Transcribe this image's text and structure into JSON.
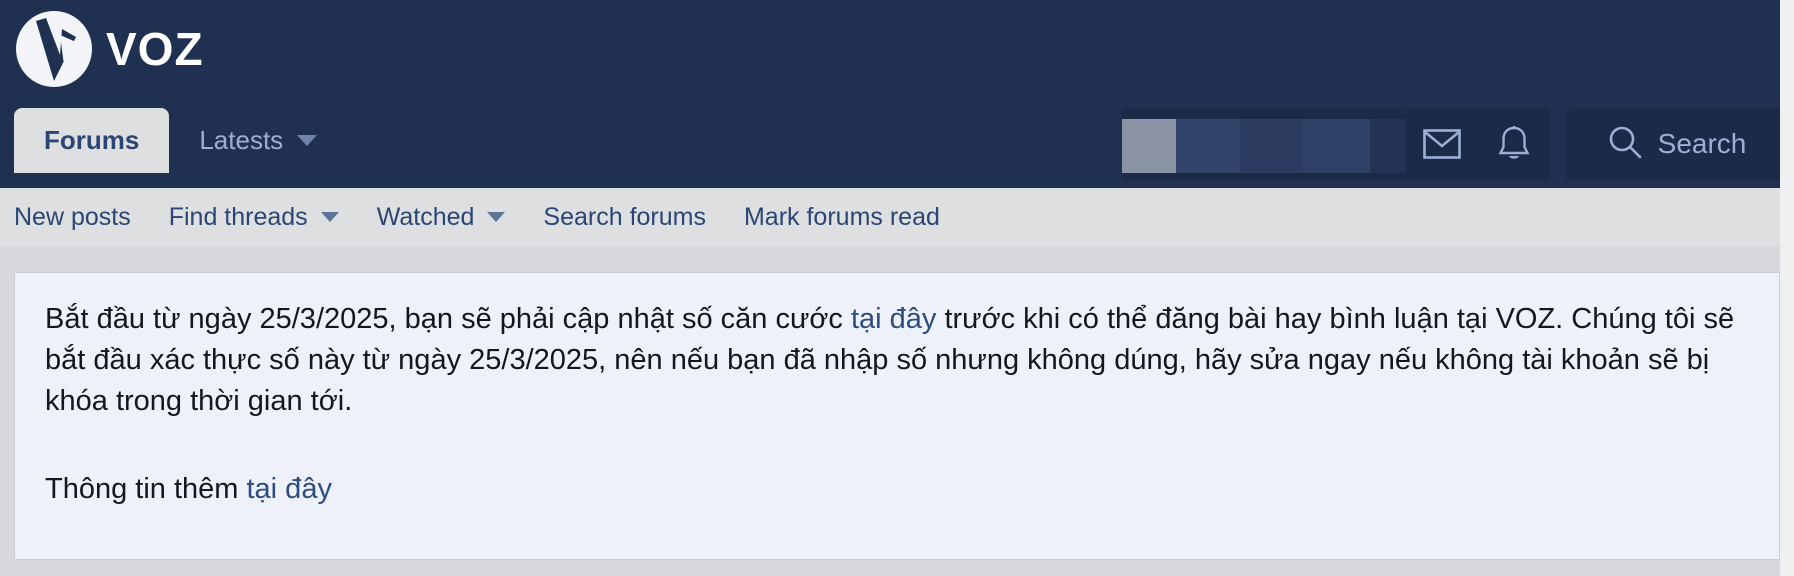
{
  "brand": {
    "name": "VOZ",
    "logo_icon": "voz-logo-icon",
    "background_color": "#1f3050"
  },
  "primary_nav": {
    "items": [
      {
        "label": "Forums",
        "active": true,
        "has_caret": false
      },
      {
        "label": "Latests",
        "active": false,
        "has_caret": true
      }
    ]
  },
  "header_right": {
    "account": {
      "label": "",
      "state": "redacted",
      "avatar_icon": "avatar"
    },
    "inbox_icon": "envelope-icon",
    "alerts_icon": "bell-icon",
    "search": {
      "label": "Search",
      "icon": "search-icon"
    }
  },
  "secondary_nav": {
    "items": [
      {
        "label": "New posts",
        "has_caret": false
      },
      {
        "label": "Find threads",
        "has_caret": true
      },
      {
        "label": "Watched",
        "has_caret": true
      },
      {
        "label": "Search forums",
        "has_caret": false
      },
      {
        "label": "Mark forums read",
        "has_caret": false
      }
    ]
  },
  "notice": {
    "paragraph1_part1": "Bắt đầu từ ngày 25/3/2025, bạn sẽ phải cập nhật số căn cước ",
    "paragraph1_link": "tại đây",
    "paragraph1_part2": " trước khi có thể đăng bài hay bình luận tại VOZ. Chúng tôi sẽ bắt đầu xác thực số này từ ngày 25/3/2025, nên nếu bạn đã nhập số nhưng không dúng, hãy sửa ngay nếu không tài khoản sẽ bị khóa trong thời gian tới.",
    "paragraph2_part1": "Thông tin thêm ",
    "paragraph2_link": "tại đây",
    "link_color": "#2d4d7f",
    "background_color": "#eef1f9"
  }
}
